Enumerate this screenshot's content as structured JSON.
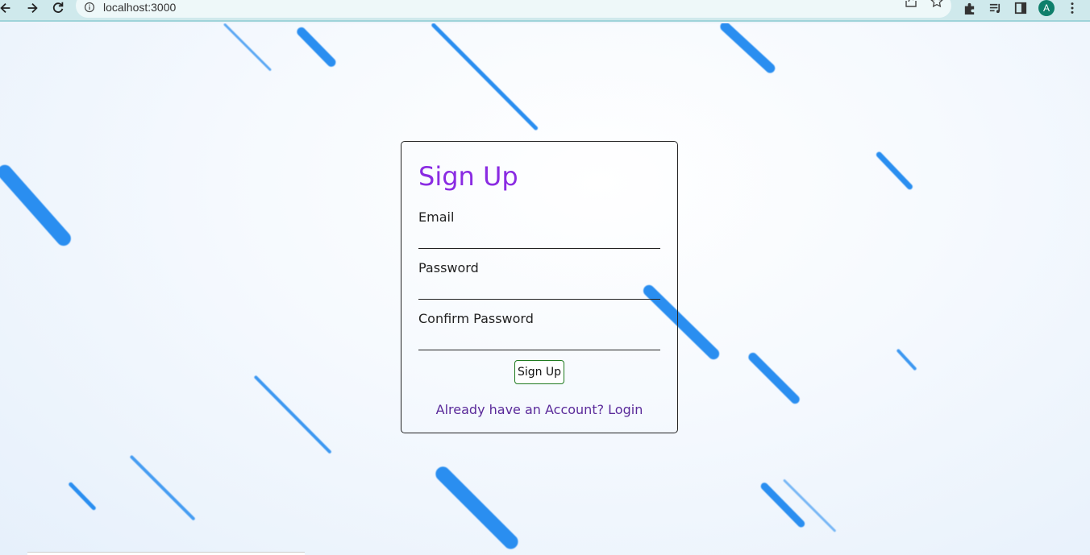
{
  "browser": {
    "url": "localhost:3000",
    "profile_initial": "A",
    "accent": "#0f7f6b",
    "icons": [
      "back-icon",
      "forward-icon",
      "reload-icon",
      "info-icon",
      "share-icon",
      "star-icon",
      "extensions-icon",
      "reading-list-icon",
      "side-panel-icon",
      "menu-icon"
    ]
  },
  "form": {
    "title": "Sign Up",
    "title_color": "#8a2be2",
    "fields": [
      {
        "label": "Email",
        "value": ""
      },
      {
        "label": "Password",
        "value": ""
      },
      {
        "label": "Confirm Password",
        "value": ""
      }
    ],
    "submit_label": "Sign Up",
    "login_link": "Already have an Account? Login"
  },
  "background": {
    "streak_color": "#2a8ef0"
  }
}
